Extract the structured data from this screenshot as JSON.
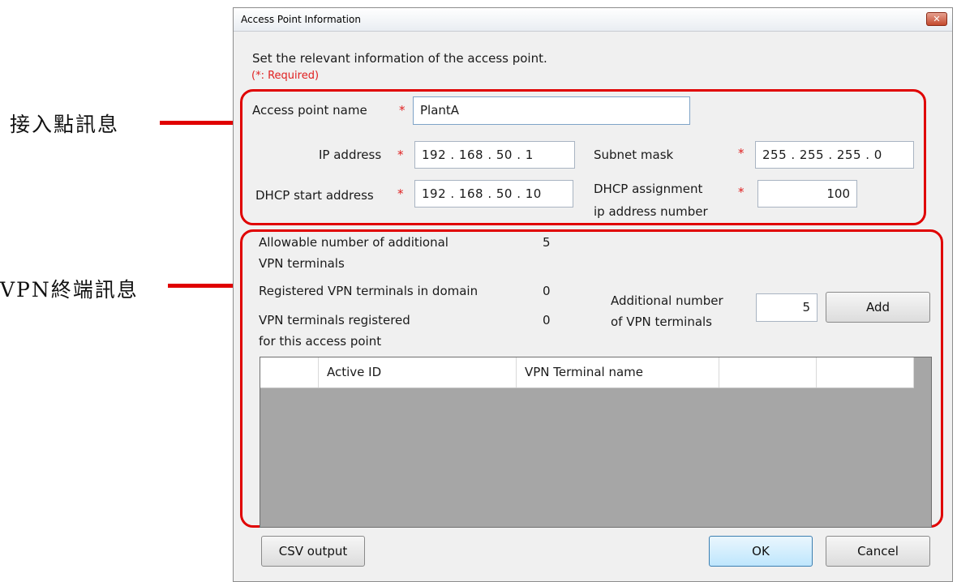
{
  "annotations": {
    "access_point_info": "接入點訊息",
    "vpn_terminal_info": "VPN終端訊息"
  },
  "dialog": {
    "title": "Access Point Information",
    "close_glyph": "✕",
    "instruction": "Set the relevant information of the access point.",
    "required_note": "(*: Required)",
    "required_mark": "*"
  },
  "access_point": {
    "name_label": "Access point name",
    "name_value": "PlantA",
    "ip_label": "IP address",
    "ip_value": "192 . 168 . 50 .  1",
    "subnet_label": "Subnet mask",
    "subnet_value": "255 . 255 . 255 .  0",
    "dhcp_start_label": "DHCP start address",
    "dhcp_start_value": "192 . 168 . 50 . 10",
    "dhcp_count_label_line1": "DHCP assignment",
    "dhcp_count_label_line2": "ip address number",
    "dhcp_count_value": "100"
  },
  "vpn": {
    "allowable_label_line1": "Allowable number of additional",
    "allowable_label_line2": "VPN terminals",
    "allowable_value": "5",
    "registered_domain_label": "Registered VPN terminals in domain",
    "registered_domain_value": "0",
    "registered_ap_label_line1": "VPN terminals registered",
    "registered_ap_label_line2": "for this access point",
    "registered_ap_value": "0",
    "additional_label_line1": "Additional number",
    "additional_label_line2": "of VPN terminals",
    "additional_value": "5",
    "add_button": "Add",
    "table": {
      "columns": [
        "",
        "Active ID",
        "VPN Terminal name",
        "",
        ""
      ],
      "rows": []
    }
  },
  "footer": {
    "csv_button": "CSV output",
    "ok_button": "OK",
    "cancel_button": "Cancel"
  },
  "colors": {
    "highlight": "#e00000",
    "required": "#e02020",
    "grid_background": "#a6a6a6"
  }
}
